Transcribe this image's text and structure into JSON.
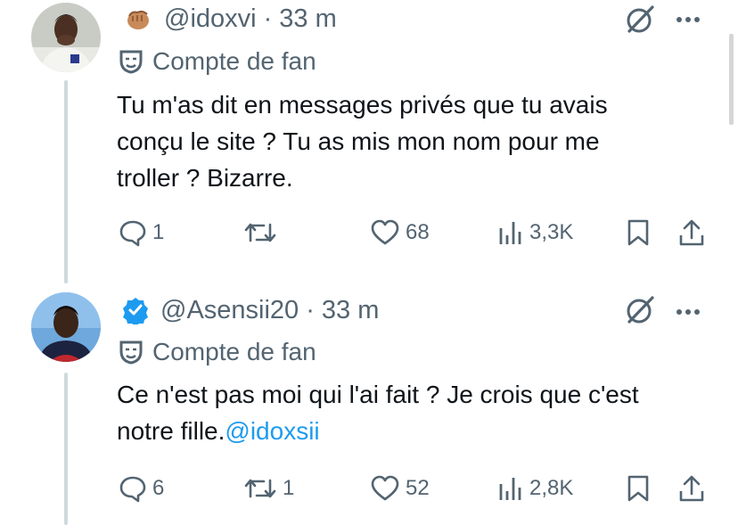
{
  "tweets": [
    {
      "handle": "@idoxvi",
      "time": "· 33 m",
      "label": "Compte de fan",
      "text_lines": [
        "Tu m'as dit en messages privés que tu avais",
        "conçu le site ? Tu as mis mon nom pour me",
        "troller ? Bizarre."
      ],
      "mention": "",
      "replies": "1",
      "retweets": "",
      "likes": "68",
      "views": "3,3K",
      "badge_icon": "fist-emoji-icon"
    },
    {
      "handle": "@Asensii20",
      "time": "· 33 m",
      "label": "Compte de fan",
      "text_lines": [
        "Ce n'est pas moi qui l'ai fait ? Je crois que c'est",
        "notre fille."
      ],
      "mention": "@idoxsii",
      "replies": "6",
      "retweets": "1",
      "likes": "52",
      "views": "2,8K",
      "badge_icon": "verified-badge-icon"
    }
  ],
  "colors": {
    "accent": "#1d9bf0",
    "secondary_text": "#536471",
    "thread_line": "#cfd9de"
  }
}
